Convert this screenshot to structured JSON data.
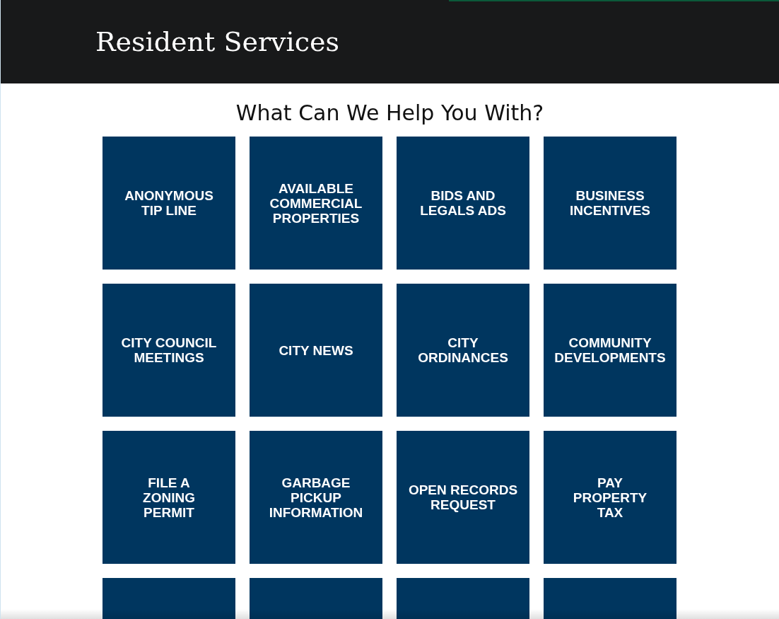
{
  "header": {
    "title": "Resident Services"
  },
  "heading": "What Can We Help You With?",
  "tiles": [
    {
      "lines": [
        "ANONYMOUS",
        "TIP LINE"
      ]
    },
    {
      "lines": [
        "AVAILABLE",
        "COMMERCIAL",
        "PROPERTIES"
      ]
    },
    {
      "lines": [
        "BIDS AND",
        "LEGALS ADS"
      ]
    },
    {
      "lines": [
        "BUSINESS",
        "INCENTIVES"
      ]
    },
    {
      "lines": [
        "CITY COUNCIL",
        "MEETINGS"
      ]
    },
    {
      "lines": [
        "CITY NEWS"
      ]
    },
    {
      "lines": [
        "CITY",
        "ORDINANCES"
      ]
    },
    {
      "lines": [
        "COMMUNITY",
        "DEVELOPMENTS"
      ]
    },
    {
      "lines": [
        "FILE A",
        "ZONING",
        "PERMIT"
      ]
    },
    {
      "lines": [
        "GARBAGE",
        "PICKUP",
        "INFORMATION"
      ]
    },
    {
      "lines": [
        "OPEN RECORDS",
        "REQUEST"
      ]
    },
    {
      "lines": [
        "PAY",
        "PROPERTY",
        "TAX"
      ]
    }
  ]
}
